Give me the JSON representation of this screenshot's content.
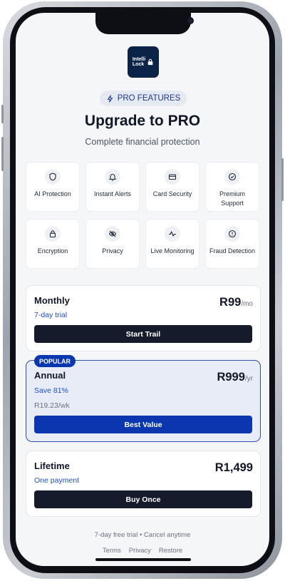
{
  "logo": {
    "line1": "Intelli",
    "line2": "Lock"
  },
  "badge": {
    "label": "PRO FEATURES",
    "icon": "lightning-icon"
  },
  "header": {
    "title": "Upgrade to PRO",
    "subtitle": "Complete financial protection"
  },
  "features": [
    {
      "label": "AI Protection",
      "icon": "shield-icon"
    },
    {
      "label": "Instant Alerts",
      "icon": "bell-icon"
    },
    {
      "label": "Card Security",
      "icon": "credit-card-icon"
    },
    {
      "label": "Premium Support",
      "icon": "check-circle-icon"
    },
    {
      "label": "Encryption",
      "icon": "lock-icon"
    },
    {
      "label": "Privacy",
      "icon": "eye-off-icon"
    },
    {
      "label": "Live Monitoring",
      "icon": "activity-icon"
    },
    {
      "label": "Fraud Detection",
      "icon": "alert-circle-icon"
    }
  ],
  "plans": {
    "monthly": {
      "name": "Monthly",
      "trial": "7-day trial",
      "price": "R99",
      "unit": "/mo",
      "button": "Start Trail"
    },
    "annual": {
      "badge": "POPULAR",
      "name": "Annual",
      "save": "Save 81%",
      "weekly": "R19.23/wk",
      "price": "R999",
      "unit": "/yr",
      "button": "Best Value"
    },
    "lifetime": {
      "name": "Lifetime",
      "note": "One payment",
      "price": "R1,499",
      "button": "Buy Once"
    }
  },
  "footer": {
    "note": "7-day free trial • Cancel anytime",
    "links": [
      "Terms",
      "Privacy",
      "Restore"
    ]
  },
  "colors": {
    "brand_dark": "#0b2346",
    "accent": "#0a37b0",
    "button_dark": "#141b2b"
  }
}
